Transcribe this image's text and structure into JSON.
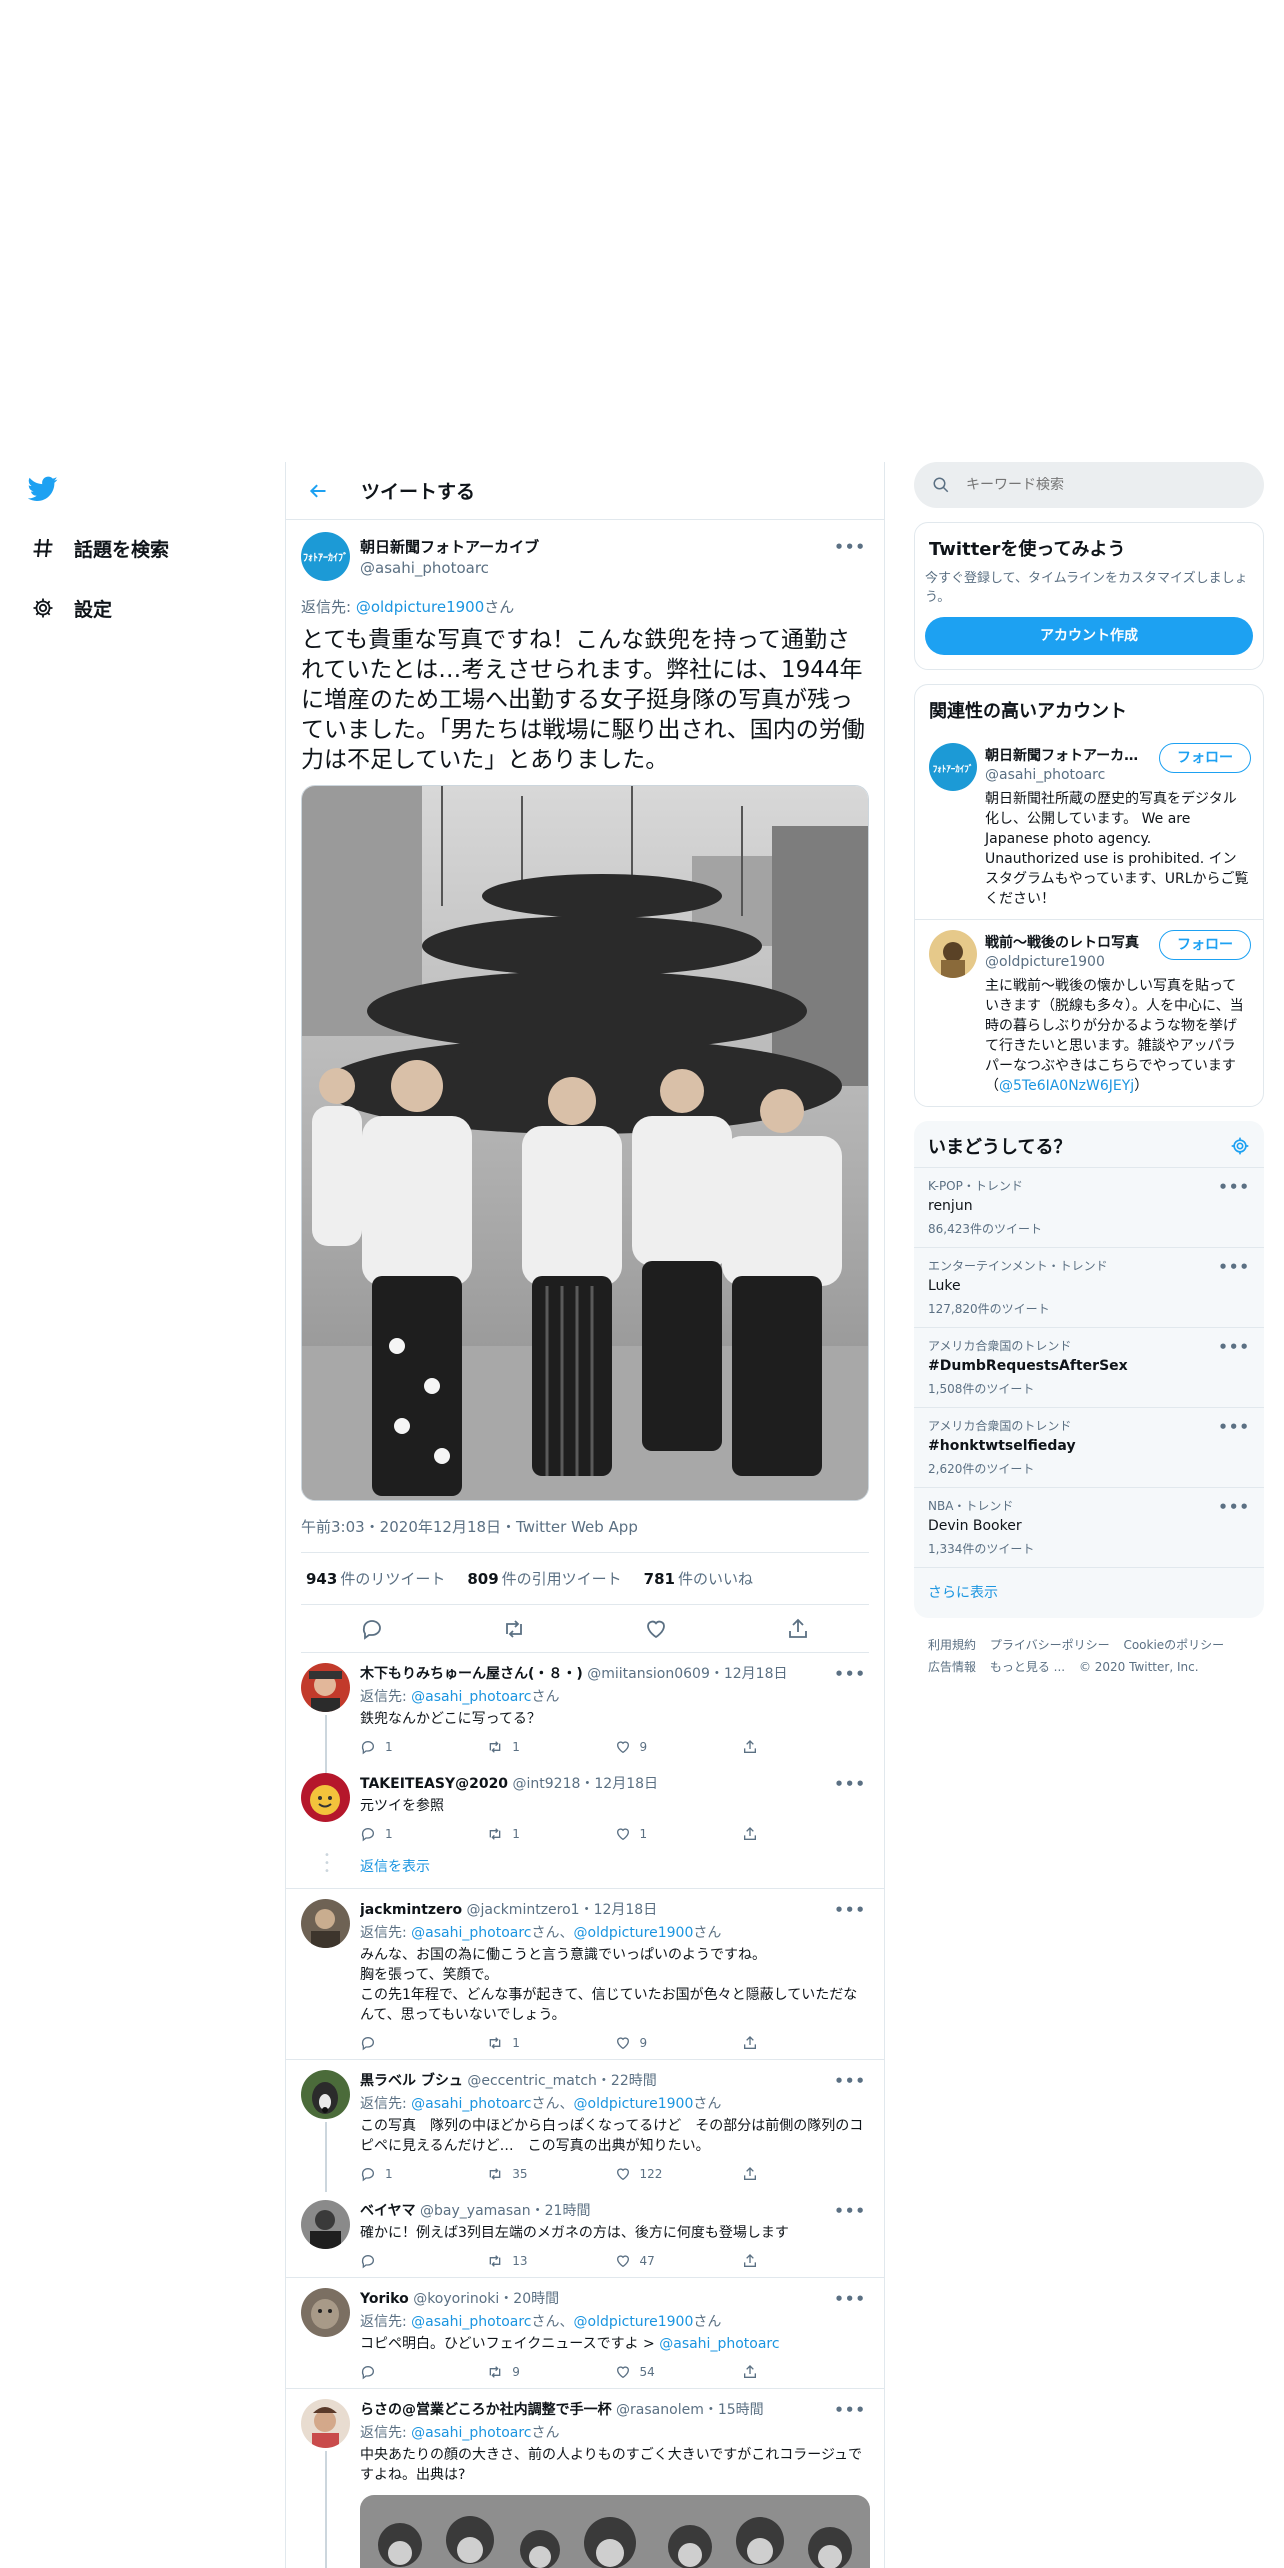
{
  "nav": {
    "items": [
      {
        "label": "話題を検索"
      },
      {
        "label": "設定"
      }
    ]
  },
  "header": {
    "title": "ツイートする"
  },
  "tweet": {
    "author_name": "朝日新聞フォトアーカイブ",
    "author_handle": "@asahi_photoarc",
    "avatar_text": "ﾌｫﾄｱｰｶｲﾌﾞ",
    "reply_prefix": "返信先: ",
    "reply_link": "@oldpicture1900",
    "reply_suffix": "さん",
    "text": "とても貴重な写真ですね！こんな鉄兜を持って通勤されていたとは…考えさせられます。弊社には、1944年に増産のため工場へ出勤する女子挺身隊の写真が残っていました。「男たちは戦場に駆り出され、国内の労働力は不足していた」とありました。",
    "meta": "午前3:03・2020年12月18日・Twitter Web App",
    "retweets": "943",
    "retweets_label": "件のリツイート",
    "quotes": "809",
    "quotes_label": "件の引用ツイート",
    "likes": "781",
    "likes_label": "件のいいね"
  },
  "replies": [
    {
      "name": "木下もりみちゅーん屋さん(・８・)",
      "handle": "@miitansion0609・12月18日",
      "reply_prefix": "返信先: ",
      "reply_links": "@asahi_photoarc",
      "reply_suffix": "さん",
      "text": "鉄兜なんかどこに写ってる？",
      "counts": {
        "reply": "1",
        "retweet": "1",
        "like": "9"
      }
    },
    {
      "name": "TAKEITEASY@2020",
      "handle": "@int9218・12月18日",
      "text": "元ツイを参照",
      "counts": {
        "reply": "1",
        "retweet": "1",
        "like": "1"
      }
    },
    {
      "name": "jackmintzero",
      "handle": "@jackmintzero1・12月18日",
      "reply_prefix": "返信先: ",
      "reply_link_a": "@asahi_photoarc",
      "reply_mid": "さん、",
      "reply_link_b": "@oldpicture1900",
      "reply_suffix": "さん",
      "text": "みんな、お国の為に働こうと言う意識でいっぱいのようですね。\n胸を張って、笑顔で。\nこの先1年程で、どんな事が起きて、信じていたお国が色々と隠蔽していただなんて、思ってもいないでしょう。",
      "counts": {
        "reply": "",
        "retweet": "1",
        "like": "9"
      }
    },
    {
      "name": "黒ラベル ブシュ",
      "handle": "@eccentric_match・22時間",
      "reply_prefix": "返信先: ",
      "reply_link_a": "@asahi_photoarc",
      "reply_mid": "さん、",
      "reply_link_b": "@oldpicture1900",
      "reply_suffix": "さん",
      "text": "この写真　隊列の中ほどから白っぽくなってるけど　その部分は前側の隊列のコピペに見えるんだけど…　この写真の出典が知りたい。",
      "counts": {
        "reply": "1",
        "retweet": "35",
        "like": "122"
      }
    },
    {
      "name": "ベイヤマ",
      "handle": "@bay_yamasan・21時間",
      "text": "確かに！例えば3列目左端のメガネの方は、後方に何度も登場します",
      "counts": {
        "reply": "",
        "retweet": "13",
        "like": "47"
      }
    },
    {
      "name": "Yoriko",
      "handle": "@koyorinoki・20時間",
      "reply_prefix": "返信先: ",
      "reply_link_a": "@asahi_photoarc",
      "reply_mid": "さん、",
      "reply_link_b": "@oldpicture1900",
      "reply_suffix": "さん",
      "text_prefix": "コピペ明白。ひどいフェイクニュースですよ > ",
      "text_link": "@asahi_photoarc",
      "counts": {
        "reply": "",
        "retweet": "9",
        "like": "54"
      }
    },
    {
      "name": "らさの@営業どころか社内調整で手一杯",
      "handle": "@rasanolem・15時間",
      "reply_prefix": "返信先: ",
      "reply_links": "@asahi_photoarc",
      "reply_suffix": "さん",
      "text": "中央あたりの顔の大きさ、前の人よりものすごく大きいですがこれコラージュですよね。出典は?"
    }
  ],
  "show_replies": "返信を表示",
  "search": {
    "placeholder": "キーワード検索"
  },
  "signup": {
    "title": "Twitterを使ってみよう",
    "desc": "今すぐ登録して、タイムラインをカスタマイズしましょう。",
    "button": "アカウント作成"
  },
  "related": {
    "title": "関連性の高いアカウント",
    "accounts": [
      {
        "name": "朝日新聞フォトアーカイブ",
        "handle": "@asahi_photoarc",
        "follow": "フォロー",
        "bio": "朝日新聞社所蔵の歴史的写真をデジタル化し、公開しています。 We are Japanese photo agency. Unauthorized use is prohibited. インスタグラムもやっています、URLからご覧ください！"
      },
      {
        "name": "戦前～戦後のレトロ写真",
        "handle": "@oldpicture1900",
        "follow": "フォロー",
        "bio": "主に戦前～戦後の懐かしい写真を貼っていきます（脱線も多々）。人を中心に、当時の暮らしぶりが分かるような物を挙げて行きたいと思います。雑談やアッパラパーなつぶやきはこちらでやっています（",
        "bio_link": "@5Te6IA0NzW6JEYj",
        "bio_end": "）"
      }
    ]
  },
  "trends": {
    "title": "いまどうしてる？",
    "items": [
      {
        "context": "K-POP・トレンド",
        "name": "renjun",
        "count": "86,423件のツイート"
      },
      {
        "context": "エンターテインメント・トレンド",
        "name": "Luke",
        "count": "127,820件のツイート"
      },
      {
        "context": "アメリカ合衆国のトレンド",
        "name": "#DumbRequestsAfterSex",
        "count": "1,508件のツイート"
      },
      {
        "context": "アメリカ合衆国のトレンド",
        "name": "#honktwtselfieday",
        "count": "2,620件のツイート"
      },
      {
        "context": "NBA・トレンド",
        "name": "Devin Booker",
        "count": "1,334件のツイート"
      }
    ],
    "show_more": "さらに表示"
  },
  "footer": {
    "links": [
      "利用規約",
      "プライバシーポリシー",
      "Cookieのポリシー",
      "広告情報",
      "もっと見る ..."
    ],
    "copyright": "© 2020 Twitter, Inc."
  },
  "colors": {
    "accent": "#1da1f2",
    "link": "#1b95e0",
    "muted": "#5b7083",
    "border": "#e1e8ed"
  }
}
